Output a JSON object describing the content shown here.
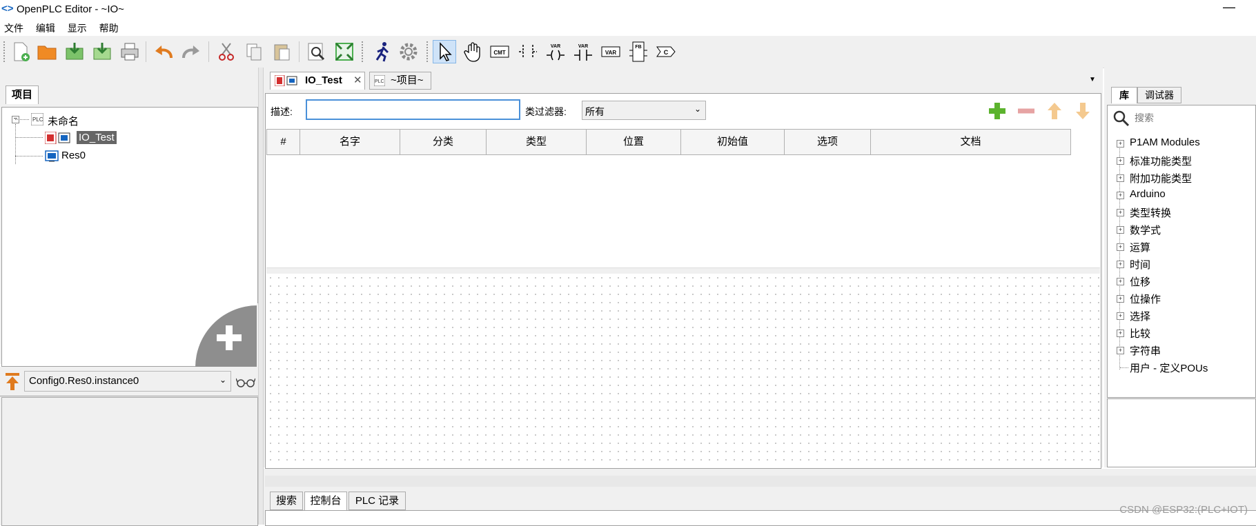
{
  "window": {
    "title": "OpenPLC Editor - ~IO~",
    "minimize_glyph": "—"
  },
  "menu": [
    "文件",
    "编辑",
    "显示",
    "帮助"
  ],
  "toolbar": {
    "icons": [
      "new-file-icon",
      "open-folder-icon",
      "save-icon",
      "save-as-icon",
      "print-icon",
      "undo-icon",
      "redo-icon",
      "cut-icon",
      "copy-icon",
      "paste-icon",
      "zoom-icon",
      "fullscreen-icon",
      "run-icon",
      "settings-icon",
      "select-cursor-icon",
      "hand-icon",
      "comment-icon",
      "contact-icon",
      "coil-var-icon",
      "contact-var-icon",
      "variable-icon",
      "function-block-icon",
      "connector-icon"
    ],
    "labels": {
      "comment": "CMT",
      "variable": "VAR",
      "function_block": "FB",
      "connector": "C"
    }
  },
  "project_panel": {
    "tab": "项目",
    "tree": {
      "root": "未命名",
      "pou": "IO_Test",
      "resource": "Res0"
    }
  },
  "instance_selector": {
    "value": "Config0.Res0.instance0"
  },
  "editor": {
    "tabs": [
      {
        "label": "IO_Test"
      },
      {
        "label": "~项目~"
      }
    ],
    "description_label": "描述:",
    "description_value": "",
    "filter_label": "类过滤器:",
    "filter_value": "所有",
    "columns": [
      "#",
      "名字",
      "分类",
      "类型",
      "位置",
      "初始值",
      "选项",
      "文档"
    ],
    "colors": {
      "add": "#5cb32e",
      "disabled": "#e6a3a3",
      "arrow_disabled": "#f4c98f"
    }
  },
  "library_panel": {
    "tabs": [
      "库",
      "调试器"
    ],
    "search_placeholder": "搜索",
    "items": [
      "P1AM Modules",
      "标准功能类型",
      "附加功能类型",
      "Arduino",
      "类型转换",
      "数学式",
      "运算",
      "时间",
      "位移",
      "位操作",
      "选择",
      "比较",
      "字符串"
    ],
    "user_item": "用户 - 定义POUs"
  },
  "bottom_panel": {
    "tabs": [
      "搜索",
      "控制台",
      "PLC 记录"
    ]
  },
  "watermark": "CSDN @ESP32:(PLC+IOT)"
}
